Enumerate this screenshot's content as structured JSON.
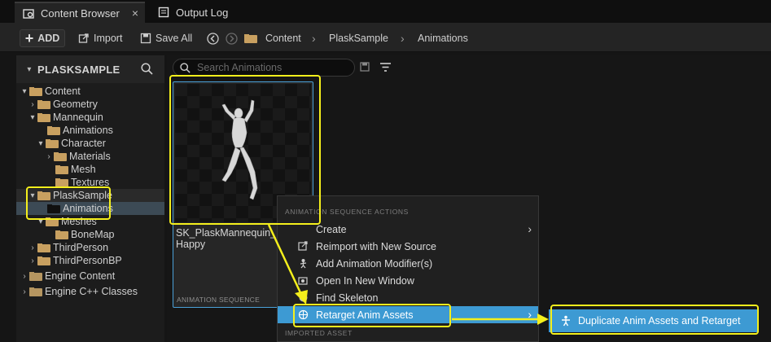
{
  "tabs": [
    {
      "label": "Content Browser",
      "icon": "content-browser-icon",
      "active": true
    },
    {
      "label": "Output Log",
      "icon": "output-log-icon",
      "active": false
    }
  ],
  "toolbar": {
    "add_label": "ADD",
    "import_label": "Import",
    "saveall_label": "Save All",
    "breadcrumbs": [
      "Content",
      "PlaskSample",
      "Animations"
    ]
  },
  "left_panel": {
    "title": "PLASKSAMPLE",
    "tree": [
      {
        "label": "Content"
      },
      {
        "label": "Geometry"
      },
      {
        "label": "Mannequin"
      },
      {
        "label": "Animations"
      },
      {
        "label": "Character"
      },
      {
        "label": "Materials"
      },
      {
        "label": "Mesh"
      },
      {
        "label": "Textures"
      },
      {
        "label": "PlaskSample"
      },
      {
        "label": "Animations"
      },
      {
        "label": "Meshes"
      },
      {
        "label": "BoneMap"
      },
      {
        "label": "ThirdPerson"
      },
      {
        "label": "ThirdPersonBP"
      },
      {
        "label": "Engine Content"
      },
      {
        "label": "Engine C++ Classes"
      }
    ]
  },
  "search": {
    "placeholder": "Search Animations"
  },
  "asset_tile": {
    "name": "SK_PlaskMannequin_F... Happy",
    "name_line1": "SK_PlaskMannequin_F",
    "name_line2": "Happy",
    "type": "ANIMATION SEQUENCE"
  },
  "context_menu": {
    "section_actions": "ANIMATION SEQUENCE ACTIONS",
    "section_imported": "IMPORTED ASSET",
    "items": [
      {
        "label": "Create",
        "icon": "create-icon",
        "submenu": true
      },
      {
        "label": "Reimport with New Source",
        "icon": "reimport-icon"
      },
      {
        "label": "Add Animation Modifier(s)",
        "icon": "modifier-icon"
      },
      {
        "label": "Open In New Window",
        "icon": "window-icon"
      },
      {
        "label": "Find Skeleton",
        "icon": "skeleton-icon"
      },
      {
        "label": "Retarget Anim Assets",
        "icon": "retarget-icon",
        "submenu": true,
        "highlighted": true
      }
    ]
  },
  "submenu": {
    "label": "Duplicate Anim Assets and Retarget",
    "icon": "retarget-figure-icon"
  },
  "colors": {
    "accent": "#3d9ad3",
    "annotation": "#f4ef1c",
    "folder": "#c8a060"
  }
}
